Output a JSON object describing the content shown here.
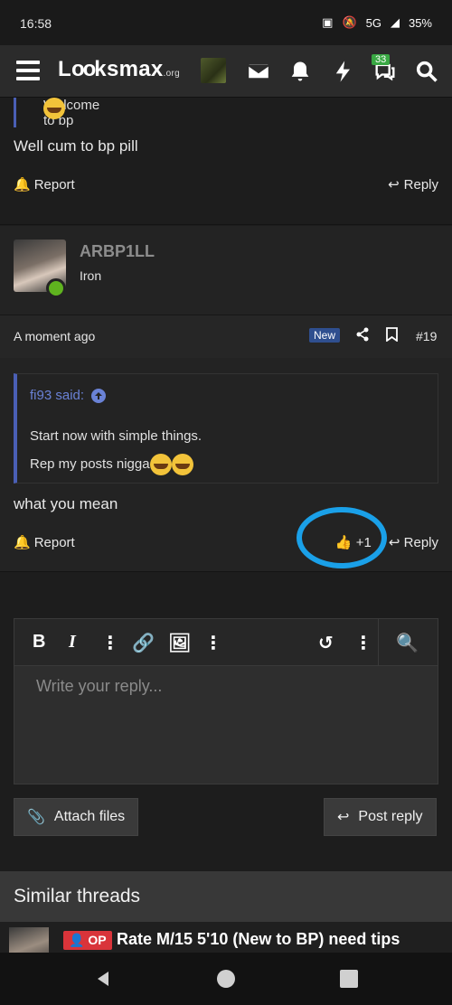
{
  "status_bar": {
    "time": "16:58",
    "network": "5G",
    "battery": "35%"
  },
  "nav": {
    "logo": "Lksmax",
    "logo_suffix": ".org",
    "logo_circle_letter": "oo",
    "conversations_badge": "33",
    "icons": [
      "menu-icon",
      "user-avatar",
      "mail-icon",
      "bell-icon",
      "bolt-icon",
      "chat-icon",
      "search-icon"
    ]
  },
  "prev_post": {
    "quote": "Welcome to bp",
    "message": "Well cum to bp pill",
    "report_label": "Report",
    "reply_label": "Reply"
  },
  "post": {
    "username": "ARBP1LL",
    "rank": "Iron",
    "time": "A moment ago",
    "new_badge": "New",
    "number": "#19",
    "quote_attrib": "fi93 said:",
    "quote_line1": "Start now with simple things.",
    "quote_line2": "Rep my posts nigga",
    "message": "what you mean",
    "report_label": "Report",
    "like_count": "+1",
    "reply_label": "Reply"
  },
  "editor": {
    "placeholder": "Write your reply..."
  },
  "buttons": {
    "attach": "Attach files",
    "post_reply": "Post reply"
  },
  "similar": {
    "heading": "Similar threads",
    "op_badge": "OP",
    "thread_title": "Rate M/15 5'10 (New to BP) need tips"
  },
  "colors": {
    "accent_blue": "#4a5fb5",
    "online_green": "#5fb31f",
    "annotation_circle": "#1aa0e8",
    "op_red": "#d9343a"
  }
}
